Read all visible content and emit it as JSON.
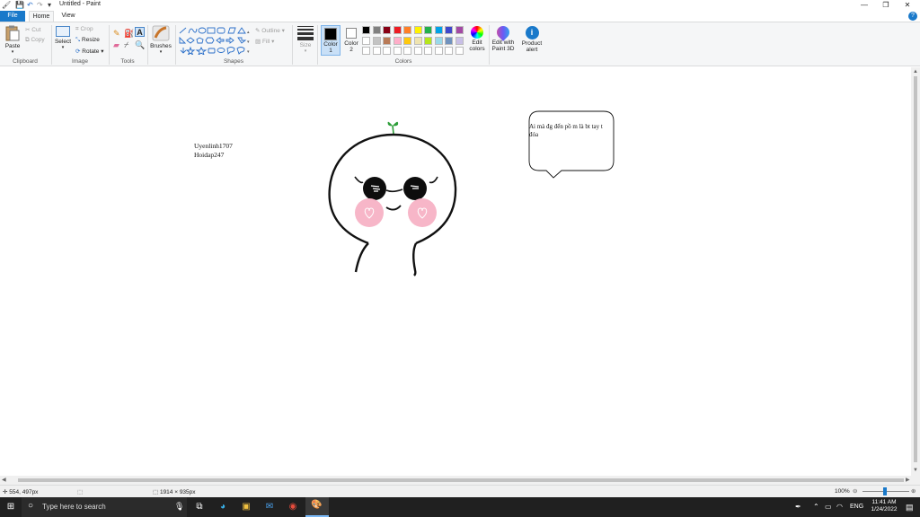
{
  "window": {
    "title": "Untitled - Paint"
  },
  "tabs": {
    "file": "File",
    "home": "Home",
    "view": "View"
  },
  "clipboard": {
    "paste": "Paste",
    "cut": "Cut",
    "copy": "Copy",
    "label": "Clipboard"
  },
  "image": {
    "select": "Select",
    "crop": "Crop",
    "resize": "Resize",
    "rotate": "Rotate",
    "label": "Image"
  },
  "tools": {
    "label": "Tools"
  },
  "brushes": {
    "label": "Brushes"
  },
  "shapes": {
    "outline": "Outline",
    "fill": "Fill",
    "label": "Shapes"
  },
  "size": {
    "label": "Size"
  },
  "colors": {
    "color1": "Color\n1",
    "color1_line1": "Color",
    "color1_line2": "1",
    "color2_line1": "Color",
    "color2_line2": "2",
    "label": "Colors",
    "edit_line1": "Edit",
    "edit_line2": "colors",
    "palette_row1": [
      "#000000",
      "#7f7f7f",
      "#880015",
      "#ed1c24",
      "#ff7f27",
      "#fff200",
      "#22b14c",
      "#00a2e8",
      "#3f48cc",
      "#a349a4"
    ],
    "palette_row2": [
      "#ffffff",
      "#c3c3c3",
      "#b97a57",
      "#ffaec9",
      "#ffc90e",
      "#efe4b0",
      "#b5e61d",
      "#99d9ea",
      "#7092be",
      "#c8bfe7"
    ]
  },
  "paint3d": {
    "line1": "Edit with",
    "line2": "Paint 3D"
  },
  "product_alert": {
    "line1": "Product",
    "line2": "alert"
  },
  "canvas": {
    "text_line1": "Uyenlinh1707",
    "text_line2": "Hoidap247",
    "bubble_line1": "Ai mà đg đến pồ m là bt tay t",
    "bubble_line2": "đóa"
  },
  "status": {
    "cursor": "554, 497px",
    "size": "1914 × 935px",
    "zoom": "100%"
  },
  "taskbar": {
    "search_placeholder": "Type here to search",
    "lang": "ENG",
    "time": "11:41 AM",
    "date": "1/24/2022"
  }
}
